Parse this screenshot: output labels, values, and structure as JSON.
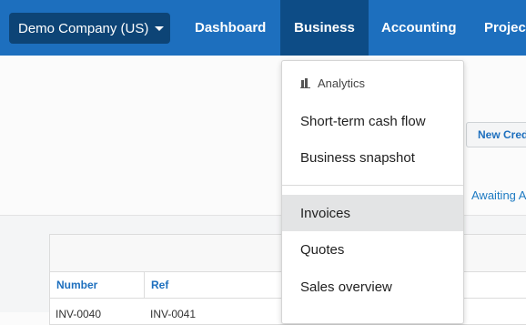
{
  "topbar": {
    "org_name": "Demo Company (US)",
    "nav": {
      "dashboard": "Dashboard",
      "business": "Business",
      "accounting": "Accounting",
      "projects": "Projec"
    },
    "brand_color": "#1d6fbe"
  },
  "actions": {
    "new_credit": "New Cred"
  },
  "tabs": {
    "awaiting": "Awaiting A"
  },
  "dropdown": {
    "section_label": "Analytics",
    "section_icon": "bar-chart-icon",
    "items": [
      {
        "label": "Short-term cash flow"
      },
      {
        "label": "Business snapshot"
      },
      {
        "label": "Invoices",
        "active": true
      },
      {
        "label": "Quotes"
      },
      {
        "label": "Sales overview"
      }
    ]
  },
  "table": {
    "columns": [
      "Number",
      "Ref"
    ],
    "rows": [
      [
        "INV-0040",
        "INV-0041"
      ]
    ]
  }
}
